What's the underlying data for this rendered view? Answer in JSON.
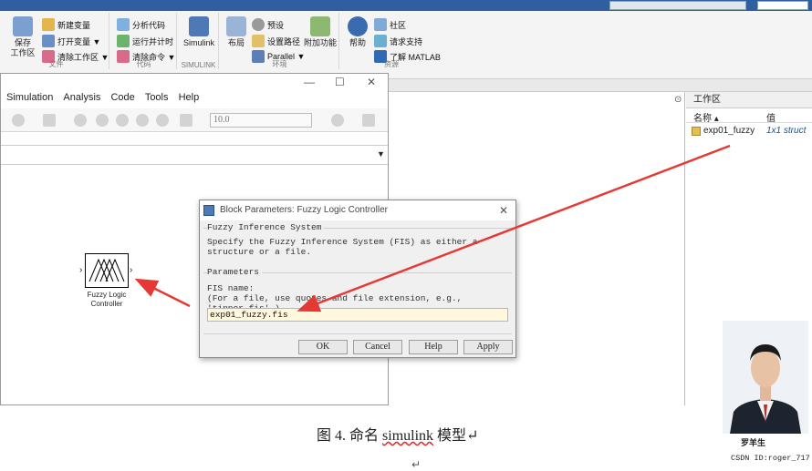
{
  "ribbon": {
    "groups": [
      {
        "label": "文件"
      },
      {
        "label": "代码"
      },
      {
        "label": "SIMULINK"
      },
      {
        "label": "环境"
      },
      {
        "label": "资源"
      }
    ],
    "save_workspace": "保存\n工作区",
    "new_variable": "新建变量",
    "open_variable": "打开变量 ▼",
    "clear_workspace": "清除工作区 ▼",
    "analyze_code": "分析代码",
    "run_timing": "运行并计时",
    "clear_commands": "清除命令 ▼",
    "simulink": "Simulink",
    "layout": "布局",
    "preferences": "预设",
    "set_path": "设置路径",
    "parallel": "Parallel ▼",
    "addons": "附加功能",
    "help": "帮助",
    "community": "社区",
    "request_support": "请求支持",
    "learn_matlab": "了解 MATLAB"
  },
  "simulink": {
    "menu": [
      "Simulation",
      "Analysis",
      "Code",
      "Tools",
      "Help"
    ],
    "stop_time": "10.0",
    "block_label_line1": "Fuzzy Logic",
    "block_label_line2": "Controller"
  },
  "workspace": {
    "title": "工作区",
    "col_name": "名称 ▴",
    "col_value": "值",
    "rows": [
      {
        "name": "exp01_fuzzy",
        "value": "1x1 struct"
      }
    ]
  },
  "dialog": {
    "title": "Block Parameters: Fuzzy Logic Controller",
    "section1": "Fuzzy Inference System",
    "description": "Specify the Fuzzy Inference System (FIS) as either a structure or a file.",
    "section2": "Parameters",
    "fis_name_label": "FIS name:",
    "fis_hint": "(For a file, use quotes and file extension, e.g., 'tipper.fis'.)",
    "fis_value": "exp01_fuzzy.fis",
    "ok": "OK",
    "cancel": "Cancel",
    "help": "Help",
    "apply": "Apply"
  },
  "caption": {
    "prefix": "图 4.  命名 ",
    "word": "simulink",
    "suffix": " 模型↵",
    "return_mark": "↵"
  },
  "photo": {
    "signature": "罗羊生",
    "csdn_id": "CSDN ID:roger_717"
  },
  "colors": {
    "arrow": "#e53935",
    "ribbon_top": "#2f5fa0",
    "fis_input_bg": "#fff8dc",
    "struct_value": "#1a4fa0"
  }
}
